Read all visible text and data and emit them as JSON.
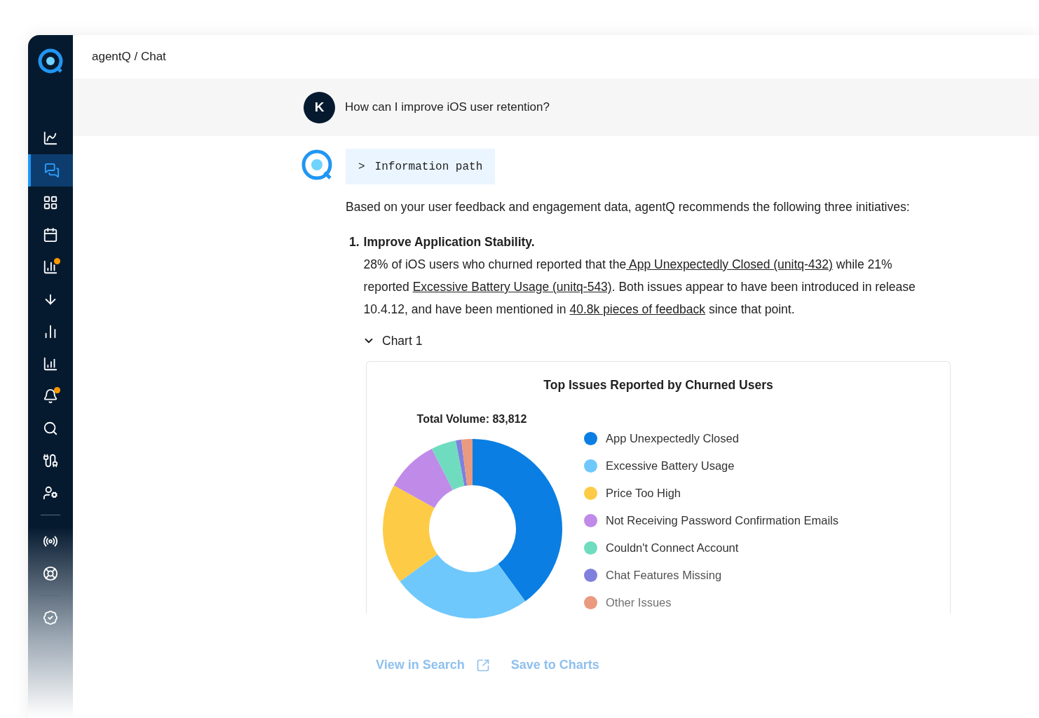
{
  "breadcrumb": "agentQ / Chat",
  "sidebar": {
    "items": [
      {
        "selected": false,
        "badge": false
      },
      {
        "selected": true,
        "badge": false
      },
      {
        "selected": false,
        "badge": false
      },
      {
        "selected": false,
        "badge": false
      },
      {
        "selected": false,
        "badge": true
      },
      {
        "selected": false,
        "badge": false
      },
      {
        "selected": false,
        "badge": false
      },
      {
        "selected": false,
        "badge": false
      },
      {
        "selected": false,
        "badge": true
      },
      {
        "selected": false,
        "badge": false
      },
      {
        "selected": false,
        "badge": false
      },
      {
        "selected": false,
        "badge": false
      },
      {
        "selected": false,
        "badge": false
      },
      {
        "selected": false,
        "badge": false
      },
      {
        "selected": false,
        "badge": false
      }
    ]
  },
  "question": {
    "avatar": "K",
    "text": "How can I improve iOS user retention?"
  },
  "answer": {
    "info_path": {
      "icon": ">",
      "label": "Information path",
      "expanded": false
    },
    "intro": "Based on your user feedback and engagement data, agentQ recommends the following three initiatives:",
    "items": [
      {
        "number": "1.",
        "title": "Improve Application Stability.",
        "body": [
          {
            "text": "28% of iOS users who churned reported that the",
            "link": false
          },
          {
            "text": " App Unexpectedly Closed (unitq-432)",
            "link": true
          },
          {
            "text": " while 21% reported ",
            "link": false
          },
          {
            "text": "Excessive Battery Usage (unitq-543)",
            "link": true
          },
          {
            "text": ". Both issues appear to have been introduced in release 10.4.12, and have been mentioned in ",
            "link": false
          },
          {
            "text": "40.8k pieces of feedback",
            "link": true
          },
          {
            "text": " since that point.",
            "link": false
          }
        ]
      }
    ],
    "chart_toggle": {
      "label": "Chart 1",
      "expanded": true
    },
    "chart": {
      "title": "Top Issues Reported by Churned Users",
      "total": "Total Volume: 83,812",
      "legend": [
        {
          "label": "App Unexpectedly Closed",
          "color": "#0a7ee3"
        },
        {
          "label": "Excessive Battery Usage",
          "color": "#6fc8fb"
        },
        {
          "label": "Price Too High",
          "color": "#fdcb45"
        },
        {
          "label": "Not Receiving Password Confirmation Emails",
          "color": "#c08ae9"
        },
        {
          "label": "Couldn't Connect Account",
          "color": "#6fdcbf"
        },
        {
          "label": "Chat Features Missing",
          "color": "#7f7fde"
        },
        {
          "label": "Other Issues",
          "color": "#e99a7f"
        }
      ]
    },
    "actions": [
      "View in Search",
      "Save to Charts"
    ]
  }
}
